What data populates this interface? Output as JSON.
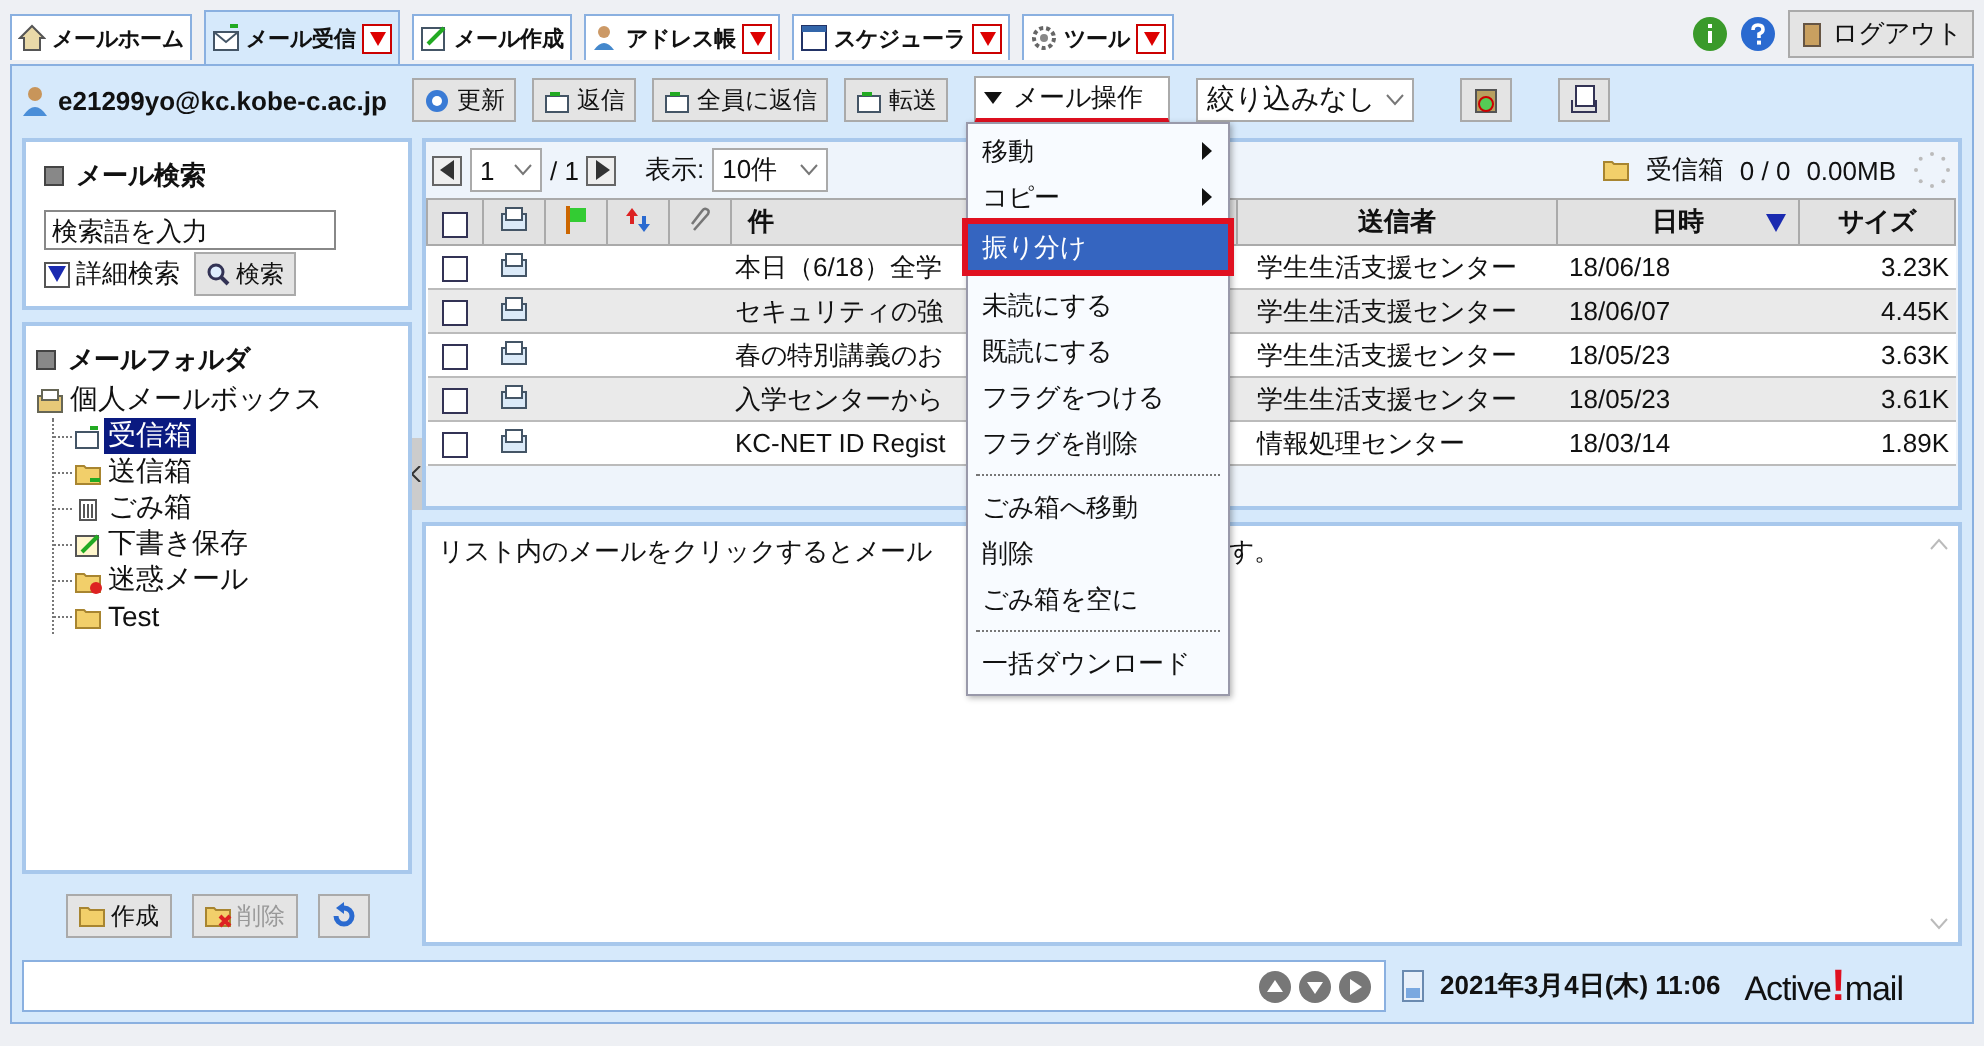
{
  "tabs": [
    {
      "label": "メールホーム",
      "has_dropdown": false,
      "selected": false
    },
    {
      "label": "メール受信",
      "has_dropdown": true,
      "selected": true
    },
    {
      "label": "メール作成",
      "has_dropdown": false,
      "selected": false
    },
    {
      "label": "アドレス帳",
      "has_dropdown": true,
      "selected": false
    },
    {
      "label": "スケジューラ",
      "has_dropdown": true,
      "selected": false
    },
    {
      "label": "ツール",
      "has_dropdown": true,
      "selected": false
    }
  ],
  "header_actions": {
    "logout": "ログアウト"
  },
  "user": "e21299yo@kc.kobe-c.ac.jp",
  "toolbar_buttons": [
    "更新",
    "返信",
    "全員に返信",
    "転送"
  ],
  "mail_ops": {
    "label": "メール操作",
    "open": true
  },
  "filter": {
    "value": "絞り込みなし"
  },
  "search": {
    "title": "メール検索",
    "placeholder": "検索語を入力",
    "advanced": "詳細検索",
    "button": "検索"
  },
  "folders": {
    "title": "メールフォルダ",
    "root": "個人メールボックス",
    "children": [
      {
        "label": "受信箱",
        "selected": true
      },
      {
        "label": "送信箱",
        "selected": false
      },
      {
        "label": "ごみ箱",
        "selected": false
      },
      {
        "label": "下書き保存",
        "selected": false
      },
      {
        "label": "迷惑メール",
        "selected": false
      },
      {
        "label": "Test",
        "selected": false
      }
    ]
  },
  "folder_buttons": [
    {
      "label": "作成",
      "disabled": false
    },
    {
      "label": "削除",
      "disabled": true
    }
  ],
  "pager": {
    "page": "1",
    "total": "/ 1",
    "display_label": "表示:",
    "per_page": "10件"
  },
  "folder_info": {
    "name": "受信箱",
    "count": "0 / 0",
    "size": "0.00MB"
  },
  "select_all": {
    "checked": false
  },
  "columns": [
    {
      "label": "件",
      "sorted": false
    },
    {
      "label": "送信者",
      "sorted": false
    },
    {
      "label": "日時",
      "sorted": true
    },
    {
      "label": "サイズ",
      "sorted": false
    }
  ],
  "rows": [
    {
      "subject": "本日（6/18）全学",
      "sender": "学生生活支援センター",
      "date": "18/06/18",
      "size": "3.23K",
      "checked": false
    },
    {
      "subject": "セキュリティの強",
      "sender": "学生生活支援センター",
      "date": "18/06/07",
      "size": "4.45K",
      "checked": false
    },
    {
      "subject": "春の特別講義のお",
      "sender": "学生生活支援センター",
      "date": "18/05/23",
      "size": "3.63K",
      "checked": false
    },
    {
      "subject": "入学センターから",
      "sender": "学生生活支援センター",
      "date": "18/05/23",
      "size": "3.61K",
      "checked": false
    },
    {
      "subject": "KC-NET ID Regist",
      "sender": "情報処理センター",
      "date": "18/03/14",
      "size": "1.89K",
      "checked": false
    }
  ],
  "preview_text": "リスト内のメールをクリックするとメール",
  "preview_text_2": "す。",
  "menu": [
    {
      "kind": "item",
      "label": "移動",
      "submenu": true,
      "selected": false
    },
    {
      "kind": "item",
      "label": "コピー",
      "submenu": true,
      "selected": false
    },
    {
      "kind": "item",
      "label": "振り分け",
      "submenu": false,
      "selected": true
    },
    {
      "kind": "item",
      "label": "未読にする",
      "submenu": false,
      "selected": false
    },
    {
      "kind": "item",
      "label": "既読にする",
      "submenu": false,
      "selected": false
    },
    {
      "kind": "item",
      "label": "フラグをつける",
      "submenu": false,
      "selected": false
    },
    {
      "kind": "item",
      "label": "フラグを削除",
      "submenu": false,
      "selected": false
    },
    {
      "kind": "separator"
    },
    {
      "kind": "item",
      "label": "ごみ箱へ移動",
      "submenu": false,
      "selected": false
    },
    {
      "kind": "item",
      "label": "削除",
      "submenu": false,
      "selected": false
    },
    {
      "kind": "item",
      "label": "ごみ箱を空に",
      "submenu": false,
      "selected": false
    },
    {
      "kind": "separator"
    },
    {
      "kind": "item",
      "label": "一括ダウンロード",
      "submenu": false,
      "selected": false
    }
  ],
  "status": {
    "datetime": "2021年3月4日(木) 11:06",
    "logo_left": "Active",
    "logo_mark": "!",
    "logo_right": "mail"
  }
}
